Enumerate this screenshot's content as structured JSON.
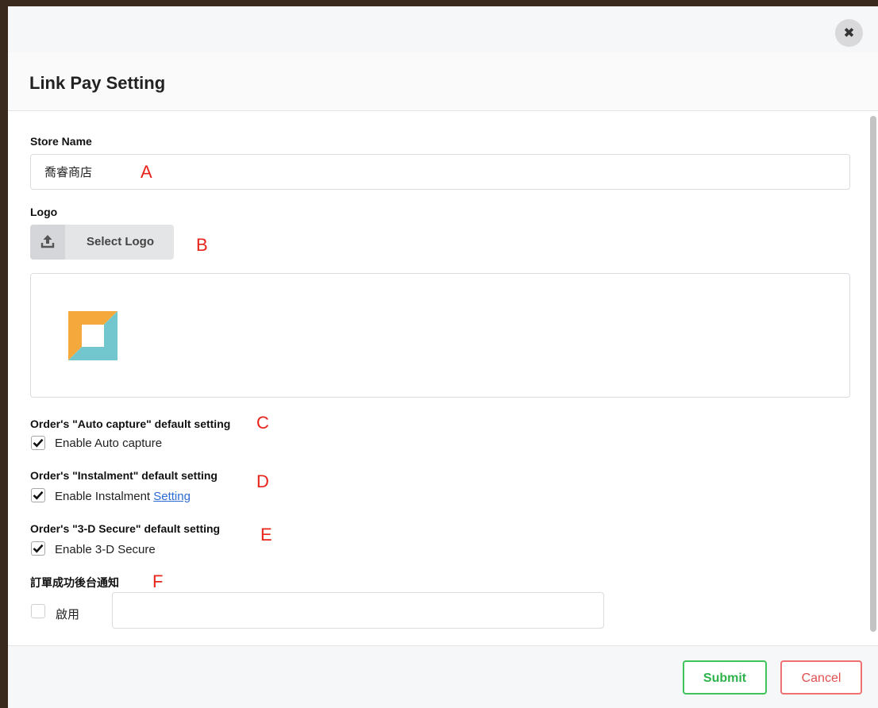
{
  "modal": {
    "title": "Link Pay Setting",
    "close_icon": "close-icon",
    "close_glyph": "✖"
  },
  "store_name": {
    "label": "Store Name",
    "value": "喬睿商店",
    "marker": "A"
  },
  "logo": {
    "label": "Logo",
    "select_button": "Select Logo",
    "upload_icon": "upload-icon",
    "marker": "B",
    "colors": {
      "orange": "#f5a93d",
      "teal": "#72c6cd"
    }
  },
  "auto_capture": {
    "heading": "Order's \"Auto capture\" default setting",
    "checkbox_label": "Enable Auto capture",
    "checked": true,
    "marker": "C"
  },
  "instalment": {
    "heading": "Order's \"Instalment\" default setting",
    "checkbox_label": "Enable Instalment",
    "link_text": "Setting",
    "checked": true,
    "marker": "D"
  },
  "three_d_secure": {
    "heading": "Order's \"3-D Secure\" default setting",
    "checkbox_label": "Enable 3-D Secure",
    "checked": true,
    "marker": "E"
  },
  "notification": {
    "heading": "訂單成功後台通知",
    "checkbox_label": "啟用",
    "checked": false,
    "input_value": "",
    "marker": "F"
  },
  "footer": {
    "submit_label": "Submit",
    "cancel_label": "Cancel",
    "submit_color": "#3ec45b",
    "cancel_color": "#ef7070"
  }
}
